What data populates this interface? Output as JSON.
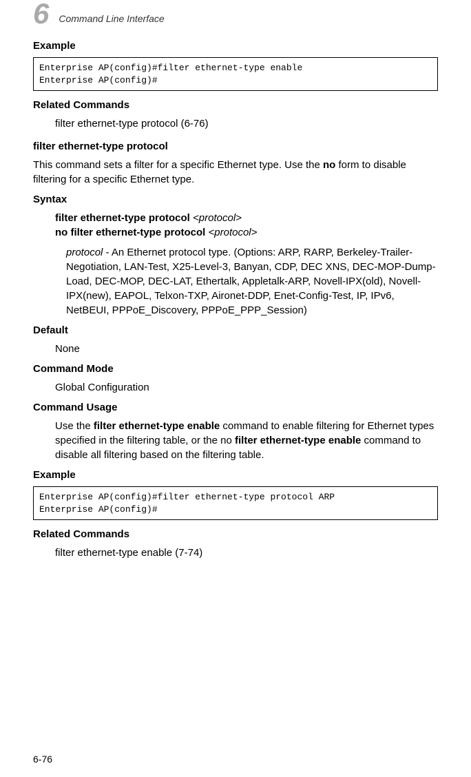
{
  "header": {
    "chapterNumber": "6",
    "chapterTitle": "Command Line Interface"
  },
  "content": {
    "exampleHeading1": "Example",
    "codeExample1Line1": "Enterprise AP(config)#filter ethernet-type enable",
    "codeExample1Line2": "Enterprise AP(config)#",
    "relatedHeading1": "Related Commands",
    "relatedText1": "filter ethernet-type protocol (6-76)",
    "commandTitle": "filter ethernet-type protocol",
    "commandDesc1": "This command sets a filter for a specific Ethernet type. Use the ",
    "commandDescBold": "no",
    "commandDesc2": " form to disable filtering for a specific Ethernet type.",
    "syntaxHeading": "Syntax",
    "syntaxLine1a": "filter ethernet-type protocol",
    "syntaxLine1b": "<protocol>",
    "syntaxLine2a": "no filter ethernet-type protocol",
    "syntaxLine2b": "<protocol>",
    "paramName": "protocol",
    "paramDesc": " - An Ethernet protocol type. (Options: ARP, RARP, Berkeley-Trailer-Negotiation, LAN-Test, X25-Level-3, Banyan, CDP, DEC XNS, DEC-MOP-Dump-Load, DEC-MOP, DEC-LAT, Ethertalk, Appletalk-ARP, Novell-IPX(old), Novell-IPX(new), EAPOL, Telxon-TXP, Aironet-DDP, Enet-Config-Test, IP, IPv6, NetBEUI, PPPoE_Discovery, PPPoE_PPP_Session)",
    "defaultHeading": "Default",
    "defaultValue": "None",
    "modeHeading": "Command Mode",
    "modeValue": "Global Configuration",
    "usageHeading": "Command Usage",
    "usageText1": "Use the ",
    "usageBold1": "filter ethernet-type enable",
    "usageText2": " command to enable filtering for Ethernet types specified in the filtering table, or the no ",
    "usageBold2": "filter ethernet-type enable",
    "usageText3": " command to disable all filtering based on the filtering table.",
    "exampleHeading2": "Example",
    "codeExample2Line1": "Enterprise AP(config)#filter ethernet-type protocol ARP",
    "codeExample2Line2": "Enterprise AP(config)#",
    "relatedHeading2": "Related Commands",
    "relatedText2": "filter ethernet-type enable (7-74)"
  },
  "footer": {
    "pageNumber": "6-76"
  }
}
